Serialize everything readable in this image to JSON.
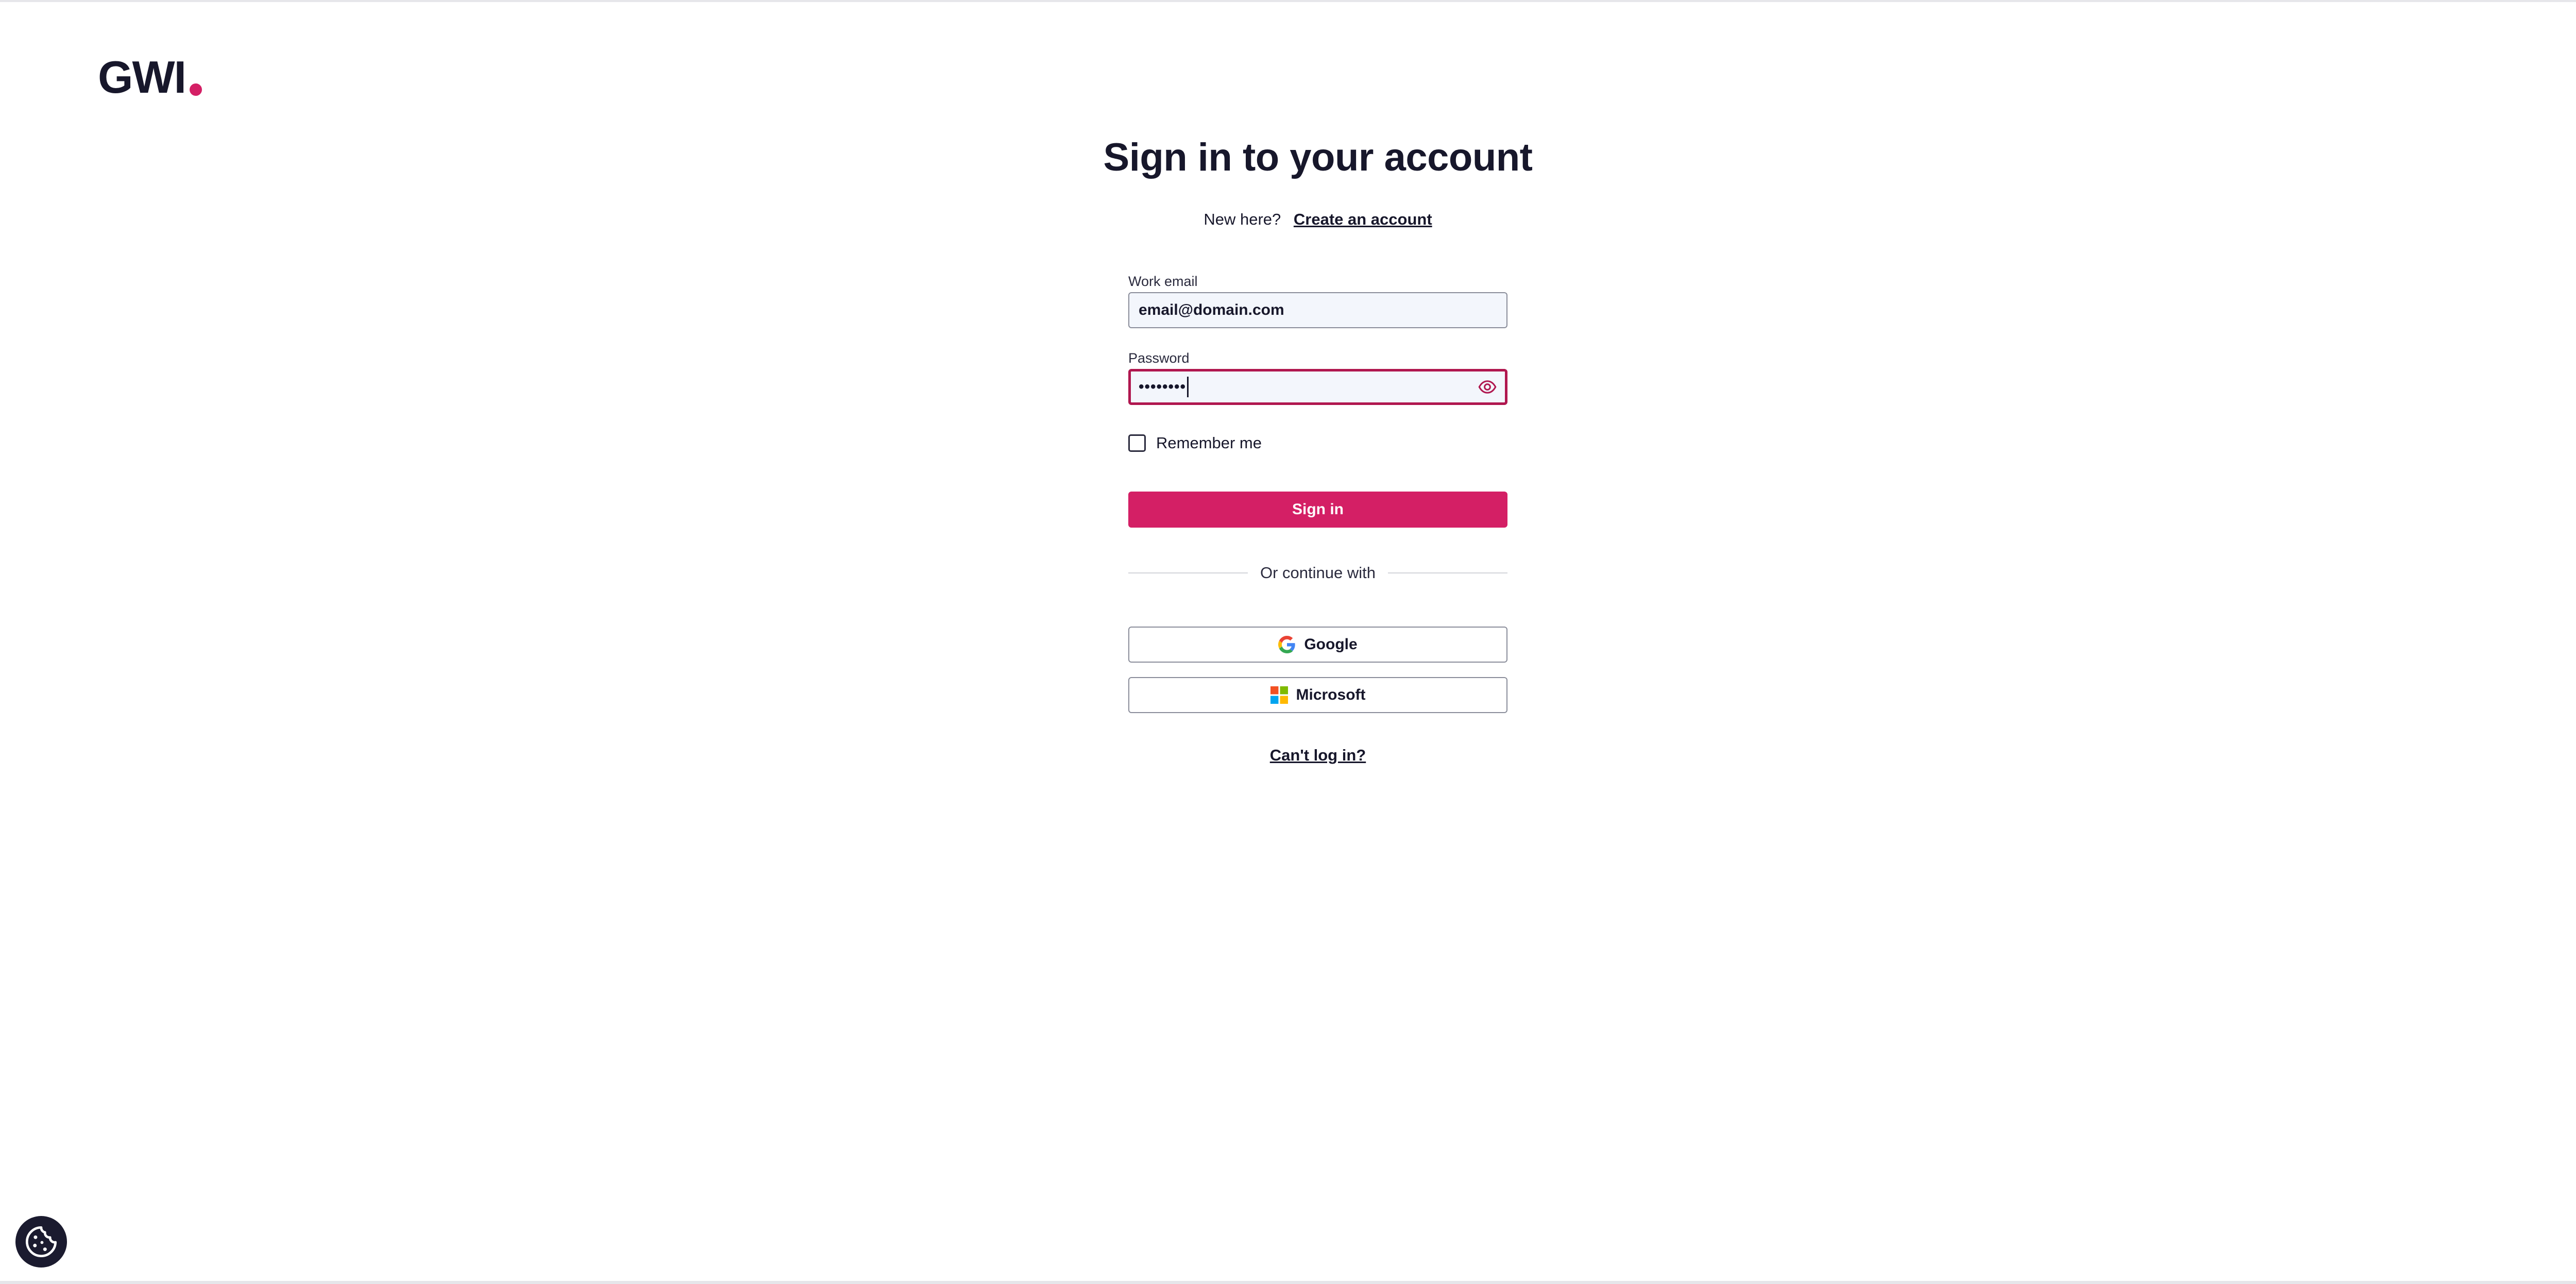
{
  "brand": {
    "logo_text": "GWI",
    "accent_color": "#d41f65"
  },
  "header": {
    "title": "Sign in to your account"
  },
  "signup": {
    "prompt": "New here?",
    "link": "Create an account"
  },
  "form": {
    "email": {
      "label": "Work email",
      "value": "email@domain.com"
    },
    "password": {
      "label": "Password",
      "masked_value": "••••••••",
      "toggle_icon": "eye-icon"
    },
    "remember": {
      "label": "Remember me",
      "checked": false
    },
    "submit_label": "Sign in"
  },
  "divider_text": "Or continue with",
  "sso": [
    {
      "label": "Google",
      "icon": "google-icon"
    },
    {
      "label": "Microsoft",
      "icon": "microsoft-icon"
    }
  ],
  "help_link": "Can't log in?",
  "cookie_icon": "cookie-icon"
}
